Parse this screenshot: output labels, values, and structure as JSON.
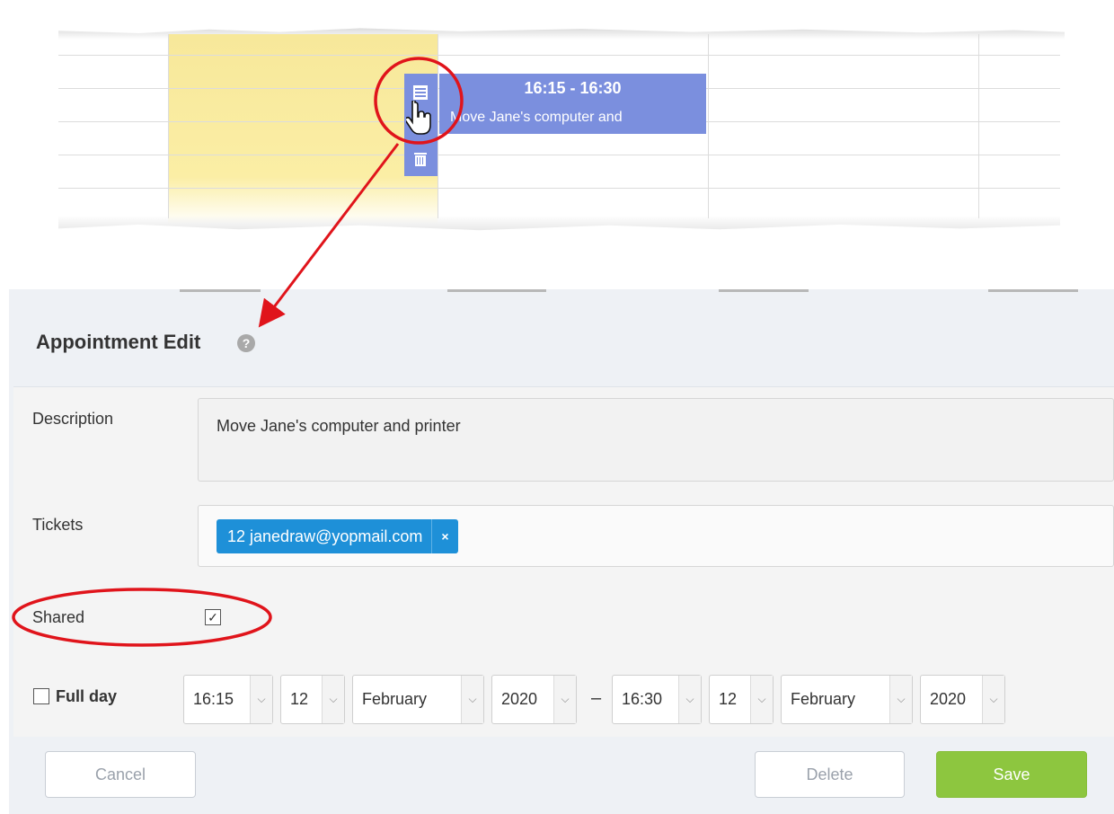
{
  "calendar": {
    "appointment": {
      "time": "16:15 - 16:30",
      "description": "Move Jane's computer and"
    },
    "colors": {
      "highlight": "#fbeea5",
      "appointment": "#7b8fde"
    }
  },
  "dialog": {
    "title": "Appointment Edit",
    "help_glyph": "?",
    "fields": {
      "description": {
        "label": "Description",
        "value": "Move Jane's computer and printer"
      },
      "tickets": {
        "label": "Tickets",
        "tag_text": "12 janedraw@yopmail.com",
        "tag_remove": "×"
      },
      "shared": {
        "label": "Shared",
        "checked": true,
        "glyph": "✓"
      },
      "full_day": {
        "label": "Full day",
        "checked": false
      }
    },
    "start": {
      "time": "16:15",
      "day": "12",
      "month": "February",
      "year": "2020"
    },
    "separator": "–",
    "end": {
      "time": "16:30",
      "day": "12",
      "month": "February",
      "year": "2020"
    },
    "buttons": {
      "cancel": "Cancel",
      "delete": "Delete",
      "save": "Save"
    },
    "colors": {
      "save": "#8dc63f",
      "tag": "#1e90d8",
      "annotation": "#e0141b"
    }
  },
  "icons": {
    "edit": "edit-icon",
    "delete": "trash-icon",
    "cursor": "hand-pointer-icon",
    "help": "help-icon",
    "dropdown": "chevron-down-icon"
  }
}
